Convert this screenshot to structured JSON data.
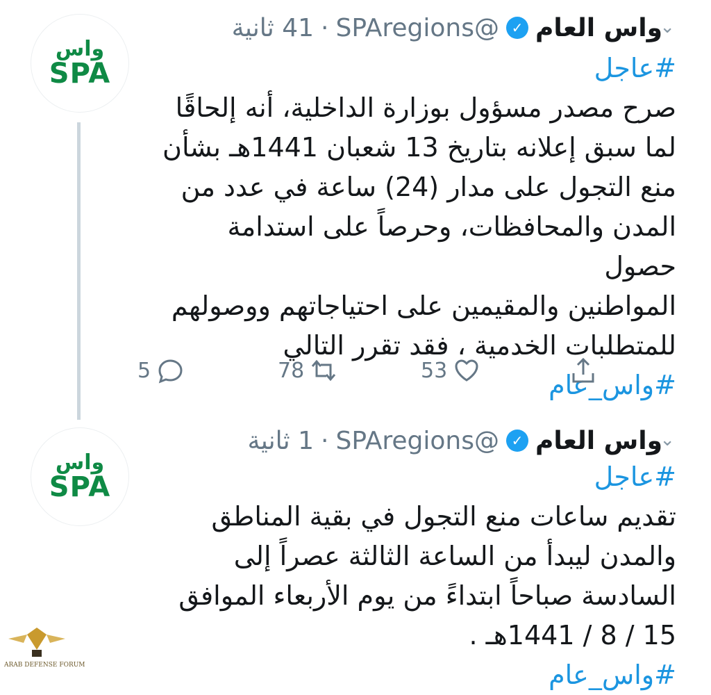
{
  "tweets": [
    {
      "avatar": {
        "line1": "واس",
        "line2": "SPA"
      },
      "name": "واس العام",
      "verified_icon": "verified-badge-icon",
      "handle": "@SPAregions",
      "dot": "·",
      "time": "41 ثانية",
      "hashtag_top": "#عاجل",
      "lines": [
        "صرح مصدر مسؤول بوزارة الداخلية، أنه إلحاقًا",
        "لما سبق إعلانه بتاريخ 13 شعبان 1441هـ بشأن",
        "منع التجول على مدار (24) ساعة في عدد من",
        "المدن والمحافظات، وحرصاً على استدامة حصول",
        "المواطنين والمقيمين على احتياجاتهم ووصولهم",
        "للمتطلبات الخدمية ، فقد تقرر التالي"
      ],
      "hashtag_bottom": "#واس_عام",
      "actions": {
        "replies": "5",
        "retweets": "78",
        "likes": "53"
      }
    },
    {
      "avatar": {
        "line1": "واس",
        "line2": "SPA"
      },
      "name": "واس العام",
      "verified_icon": "verified-badge-icon",
      "handle": "@SPAregions",
      "dot": "·",
      "time": "1 ثانية",
      "hashtag_top": "#عاجل",
      "lines": [
        "تقديم ساعات منع التجول في بقية  المناطق",
        "والمدن ليبدأ  من الساعة الثالثة عصراً إلى",
        "السادسة صباحاً ابتداءً من يوم الأربعاء الموافق",
        "15 / 8 / 1441هـ ."
      ],
      "hashtag_bottom": "#واس_عام"
    }
  ],
  "watermark": {
    "text": "ARAB DEFENSE FORUM"
  }
}
